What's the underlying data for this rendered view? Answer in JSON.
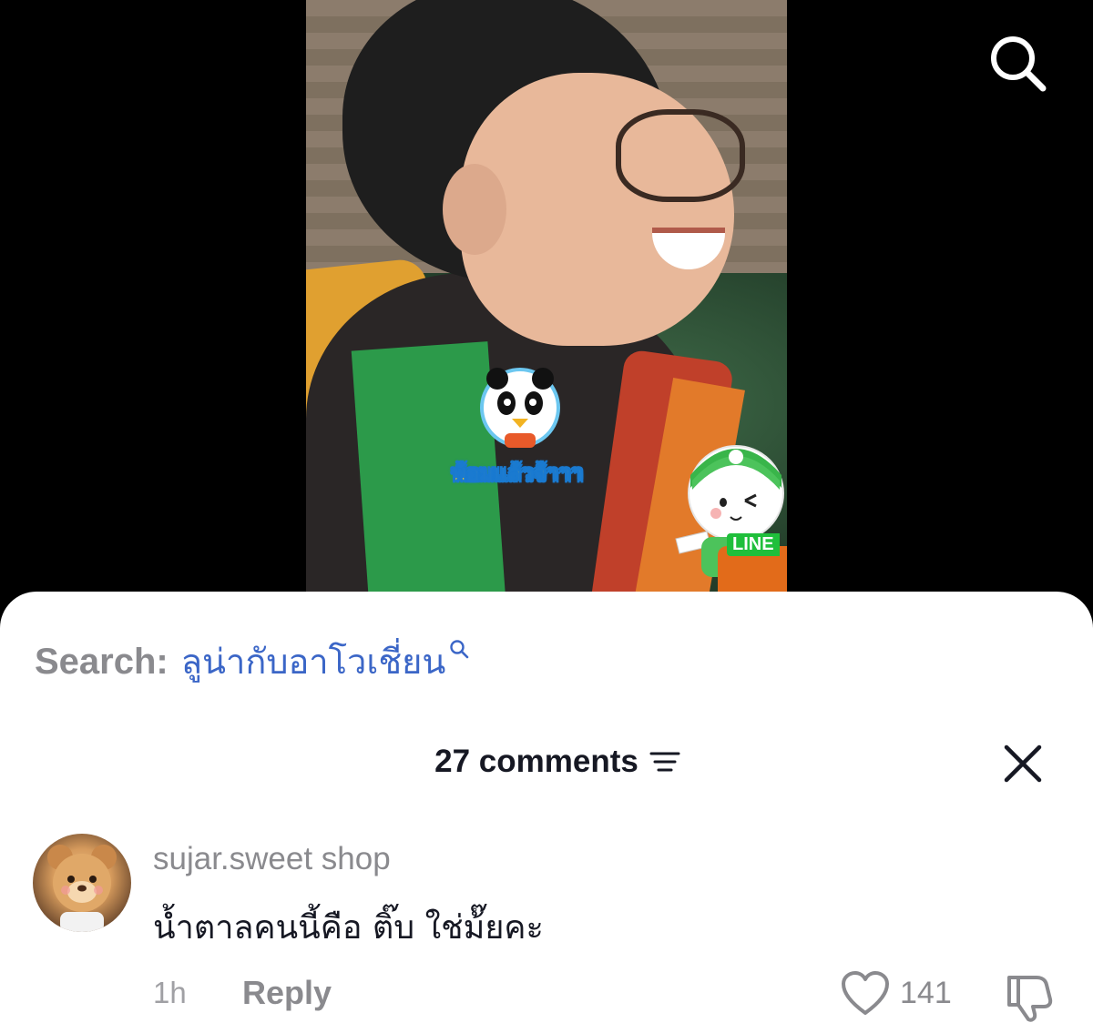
{
  "video": {
    "sticker_text": "พ้อมแล้วจ้าาา",
    "line_badge": "LINE"
  },
  "top_bar": {
    "search_icon": "search-icon"
  },
  "search_suggestion": {
    "label": "Search:",
    "term": "ลูน่ากับอาโวเชี่ยน",
    "icon": "search-icon"
  },
  "comments_header": {
    "count_label": "27 comments",
    "sort_icon": "sort-icon",
    "close_icon": "close-icon"
  },
  "comments": [
    {
      "username": "sujar.sweet shop",
      "text": "น้ำตาลคนนี้คือ ติ๊บ ใช่ม้๊ยคะ",
      "time": "1h",
      "reply_label": "Reply",
      "likes": "141",
      "like_icon": "heart-icon",
      "dislike_icon": "thumbs-down-icon"
    }
  ],
  "colors": {
    "search_term": "#3b66c7",
    "muted_text": "#8a8a8e",
    "primary_text": "#161823",
    "sheet_bg": "#ffffff",
    "backdrop": "#000000"
  }
}
